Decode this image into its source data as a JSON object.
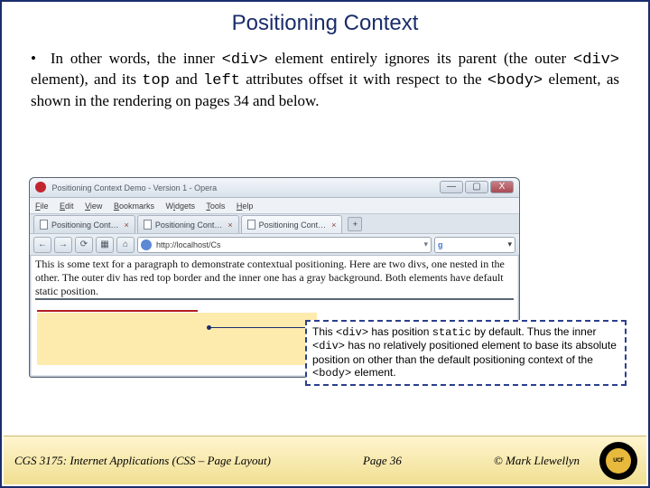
{
  "title": "Positioning Context",
  "bullet": {
    "pre1": "In other words, the inner ",
    "code1": "<div>",
    "mid1": " element entirely ignores its parent (the outer ",
    "code2": "<div>",
    "mid2": " element), and its ",
    "code3": "top",
    "mid3": " and ",
    "code4": "left",
    "mid4": " attributes offset it with respect to the ",
    "code5": "<body>",
    "mid5": " element, as shown in the rendering on pages 34 and below."
  },
  "browser": {
    "window_title": "Positioning Context Demo - Version 1 - Opera",
    "menu": {
      "file": "File",
      "edit": "Edit",
      "view": "View",
      "bookmarks": "Bookmarks",
      "widgets": "Widgets",
      "tools": "Tools",
      "help": "Help"
    },
    "tabs": [
      {
        "label": "Positioning Cont…"
      },
      {
        "label": "Positioning Cont…"
      },
      {
        "label": "Positioning Cont…"
      }
    ],
    "address": "http://localhost/Cs",
    "content_paragraph": "This is some text for a paragraph to demonstrate contextual positioning. Here are two divs, one nested in the other. The outer div has red top border and the inner one has a gray background. Both elements have default static position."
  },
  "callout": {
    "t1": "This ",
    "c1": "<div>",
    "t2": " has position ",
    "c2": "static",
    "t3": " by default.  Thus the inner ",
    "c3": "<div>",
    "t4": " has no relatively positioned element to base its absolute position on other than the default positioning context of the ",
    "c4": "<body>",
    "t5": " element."
  },
  "footer": {
    "left": "CGS 3175: Internet Applications (CSS – Page Layout)",
    "center": "Page 36",
    "right": "© Mark Llewellyn"
  },
  "win": {
    "min": "—",
    "max": "▢",
    "close": "X"
  },
  "nav": {
    "back": "←",
    "fwd": "→",
    "reload": "⟳",
    "stop": "▦",
    "home": "⌂",
    "dd": "▾",
    "plus": "+",
    "x": "×"
  },
  "ucf": "UCF"
}
